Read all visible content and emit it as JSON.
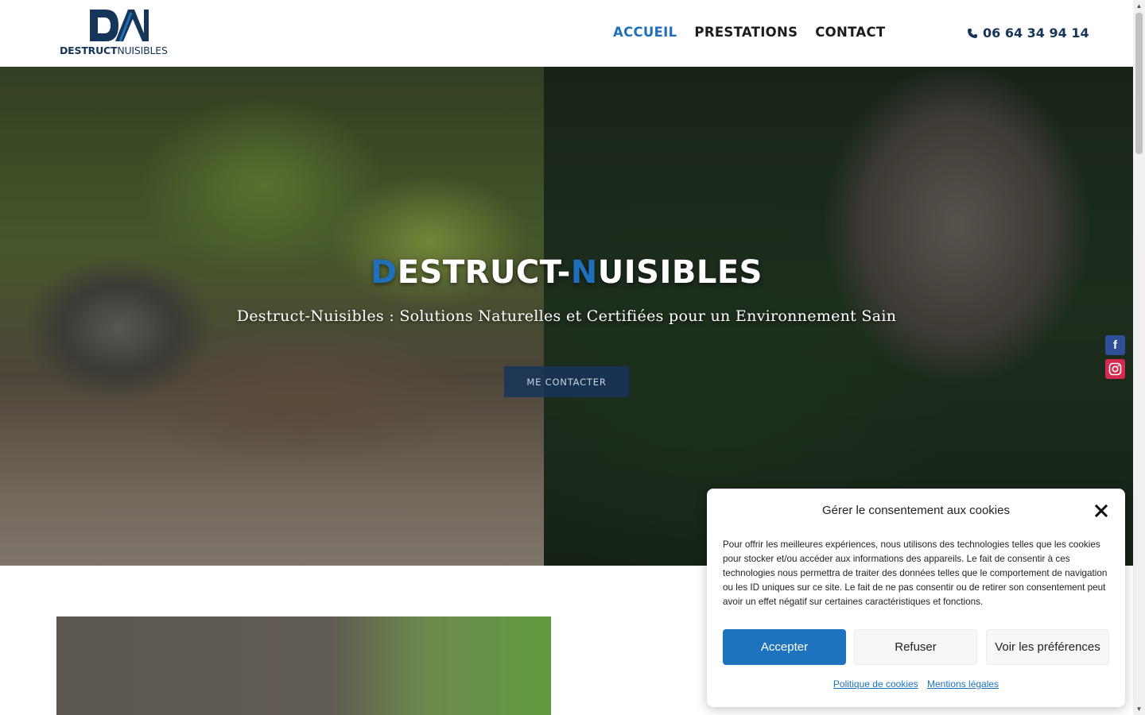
{
  "brand": {
    "logo_mark": "DN",
    "logo_word_bold": "DESTRUCT",
    "logo_word_light": "NUISIBLES",
    "primary_color": "#16355a",
    "accent_color": "#1f6fba"
  },
  "nav": {
    "items": [
      {
        "label": "ACCUEIL",
        "active": true
      },
      {
        "label": "PRESTATIONS",
        "active": false
      },
      {
        "label": "CONTACT",
        "active": false
      }
    ],
    "phone_icon": "phone-icon",
    "phone": "06 64 34 94 14"
  },
  "hero": {
    "title_first": "D",
    "title_mid": "ESTRUCT-",
    "title_second": "N",
    "title_rest": "UISIBLES",
    "subtitle": "Destruct-Nuisibles : Solutions Naturelles et Certifiées pour un Environnement Sain",
    "cta": "ME CONTACTER"
  },
  "social": [
    {
      "icon": "facebook-icon",
      "glyph": "f",
      "color": "#2f4f99"
    },
    {
      "icon": "instagram-icon",
      "glyph": "",
      "color": "#d6294f"
    }
  ],
  "cookie": {
    "title": "Gérer le consentement aux cookies",
    "close_icon": "close-icon",
    "text": "Pour offrir les meilleures expériences, nous utilisons des technologies telles que les cookies pour stocker et/ou accéder aux informations des appareils. Le fait de consentir à ces technologies nous permettra de traiter des données telles que le comportement de navigation ou les ID uniques sur ce site. Le fait de ne pas consentir ou de retirer son consentement peut avoir un effet négatif sur certaines caractéristiques et fonctions.",
    "accept": "Accepter",
    "refuse": "Refuser",
    "preferences": "Voir les préférences",
    "link_policy": "Politique de cookies",
    "link_legal": "Mentions légales"
  }
}
